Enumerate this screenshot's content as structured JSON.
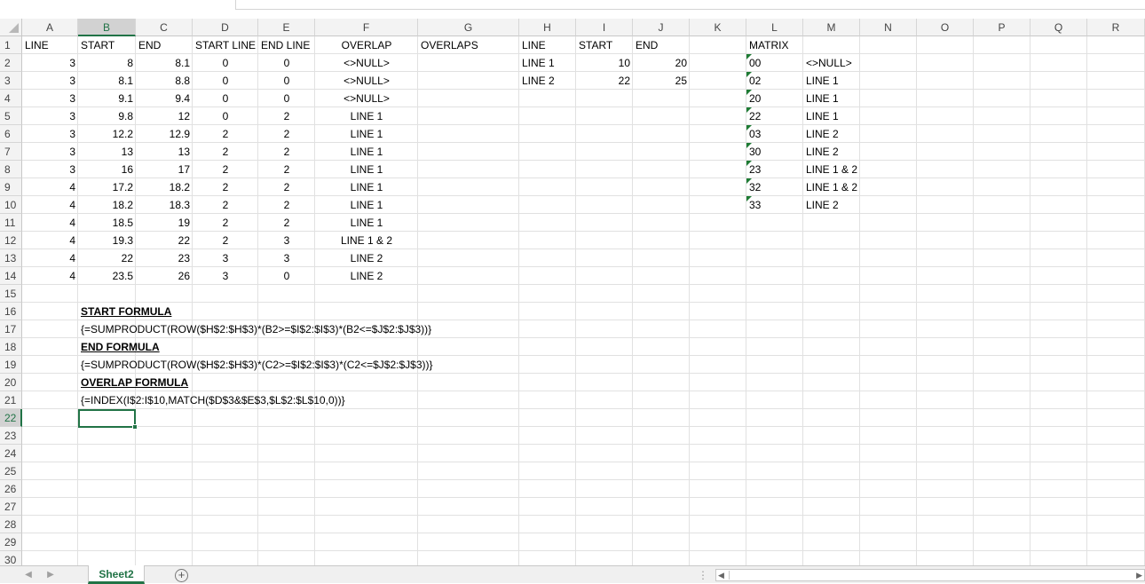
{
  "columns": [
    "A",
    "B",
    "C",
    "D",
    "E",
    "F",
    "G",
    "H",
    "I",
    "J",
    "K",
    "L",
    "M",
    "N",
    "O",
    "P",
    "Q",
    "R"
  ],
  "rows": [
    "1",
    "2",
    "3",
    "4",
    "5",
    "6",
    "7",
    "8",
    "9",
    "10",
    "11",
    "12",
    "13",
    "14",
    "15",
    "16",
    "17",
    "18",
    "19",
    "20",
    "21",
    "22",
    "23",
    "24",
    "25",
    "26",
    "27",
    "28",
    "29",
    "30"
  ],
  "selected_cell": "B22",
  "headers": {
    "A1": "LINE",
    "B1": "START",
    "C1": "END",
    "D1": "START LINE",
    "E1": "END LINE",
    "F1": "OVERLAP",
    "G1": "OVERLAPS",
    "H1": "LINE",
    "I1": "START",
    "J1": "END",
    "L1": "MATRIX"
  },
  "main_table": [
    [
      "3",
      "8",
      "8.1",
      "0",
      "0",
      "<>NULL>"
    ],
    [
      "3",
      "8.1",
      "8.8",
      "0",
      "0",
      "<>NULL>"
    ],
    [
      "3",
      "9.1",
      "9.4",
      "0",
      "0",
      "<>NULL>"
    ],
    [
      "3",
      "9.8",
      "12",
      "0",
      "2",
      "LINE 1"
    ],
    [
      "3",
      "12.2",
      "12.9",
      "2",
      "2",
      "LINE 1"
    ],
    [
      "3",
      "13",
      "13",
      "2",
      "2",
      "LINE 1"
    ],
    [
      "3",
      "16",
      "17",
      "2",
      "2",
      "LINE 1"
    ],
    [
      "4",
      "17.2",
      "18.2",
      "2",
      "2",
      "LINE 1"
    ],
    [
      "4",
      "18.2",
      "18.3",
      "2",
      "2",
      "LINE 1"
    ],
    [
      "4",
      "18.5",
      "19",
      "2",
      "2",
      "LINE 1"
    ],
    [
      "4",
      "19.3",
      "22",
      "2",
      "3",
      "LINE 1 & 2"
    ],
    [
      "4",
      "22",
      "23",
      "3",
      "3",
      "LINE 2"
    ],
    [
      "4",
      "23.5",
      "26",
      "3",
      "0",
      "LINE 2"
    ]
  ],
  "lines_table": [
    [
      "LINE 1",
      "10",
      "20"
    ],
    [
      "LINE 2",
      "22",
      "25"
    ]
  ],
  "matrix": [
    [
      "00",
      "<>NULL>"
    ],
    [
      "02",
      "LINE 1"
    ],
    [
      "20",
      "LINE 1"
    ],
    [
      "22",
      "LINE 1"
    ],
    [
      "03",
      "LINE 2"
    ],
    [
      "30",
      "LINE 2"
    ],
    [
      "23",
      "LINE 1 & 2"
    ],
    [
      "32",
      "LINE 1 & 2"
    ],
    [
      "33",
      "LINE 2"
    ]
  ],
  "notes": {
    "start_title": "START FORMULA",
    "start_formula": "{=SUMPRODUCT(ROW($H$2:$H$3)*(B2>=$I$2:$I$3)*(B2<=$J$2:$J$3))}",
    "end_title": "END FORMULA",
    "end_formula": "{=SUMPRODUCT(ROW($H$2:$H$3)*(C2>=$I$2:$I$3)*(C2<=$J$2:$J$3))}",
    "overlap_title": "OVERLAP FORMULA",
    "overlap_formula": "{=INDEX(I$2:I$10,MATCH($D$3&$E$3,$L$2:$L$10,0))}"
  },
  "sheet_tabs": [
    "Sheet2"
  ],
  "active_sheet": "Sheet2",
  "icons": {
    "select_all": "select-all-triangle-icon",
    "prev_sheet": "chevron-left-icon",
    "next_sheet": "chevron-right-icon",
    "add_sheet": "plus-circle-icon",
    "scroll_left": "triangle-left-icon",
    "scroll_right": "triangle-right-icon"
  },
  "colors": {
    "accent": "#217346",
    "error_flag": "#1e7b34",
    "grid": "#e1e1e1",
    "header_bg": "#f3f3f3"
  }
}
